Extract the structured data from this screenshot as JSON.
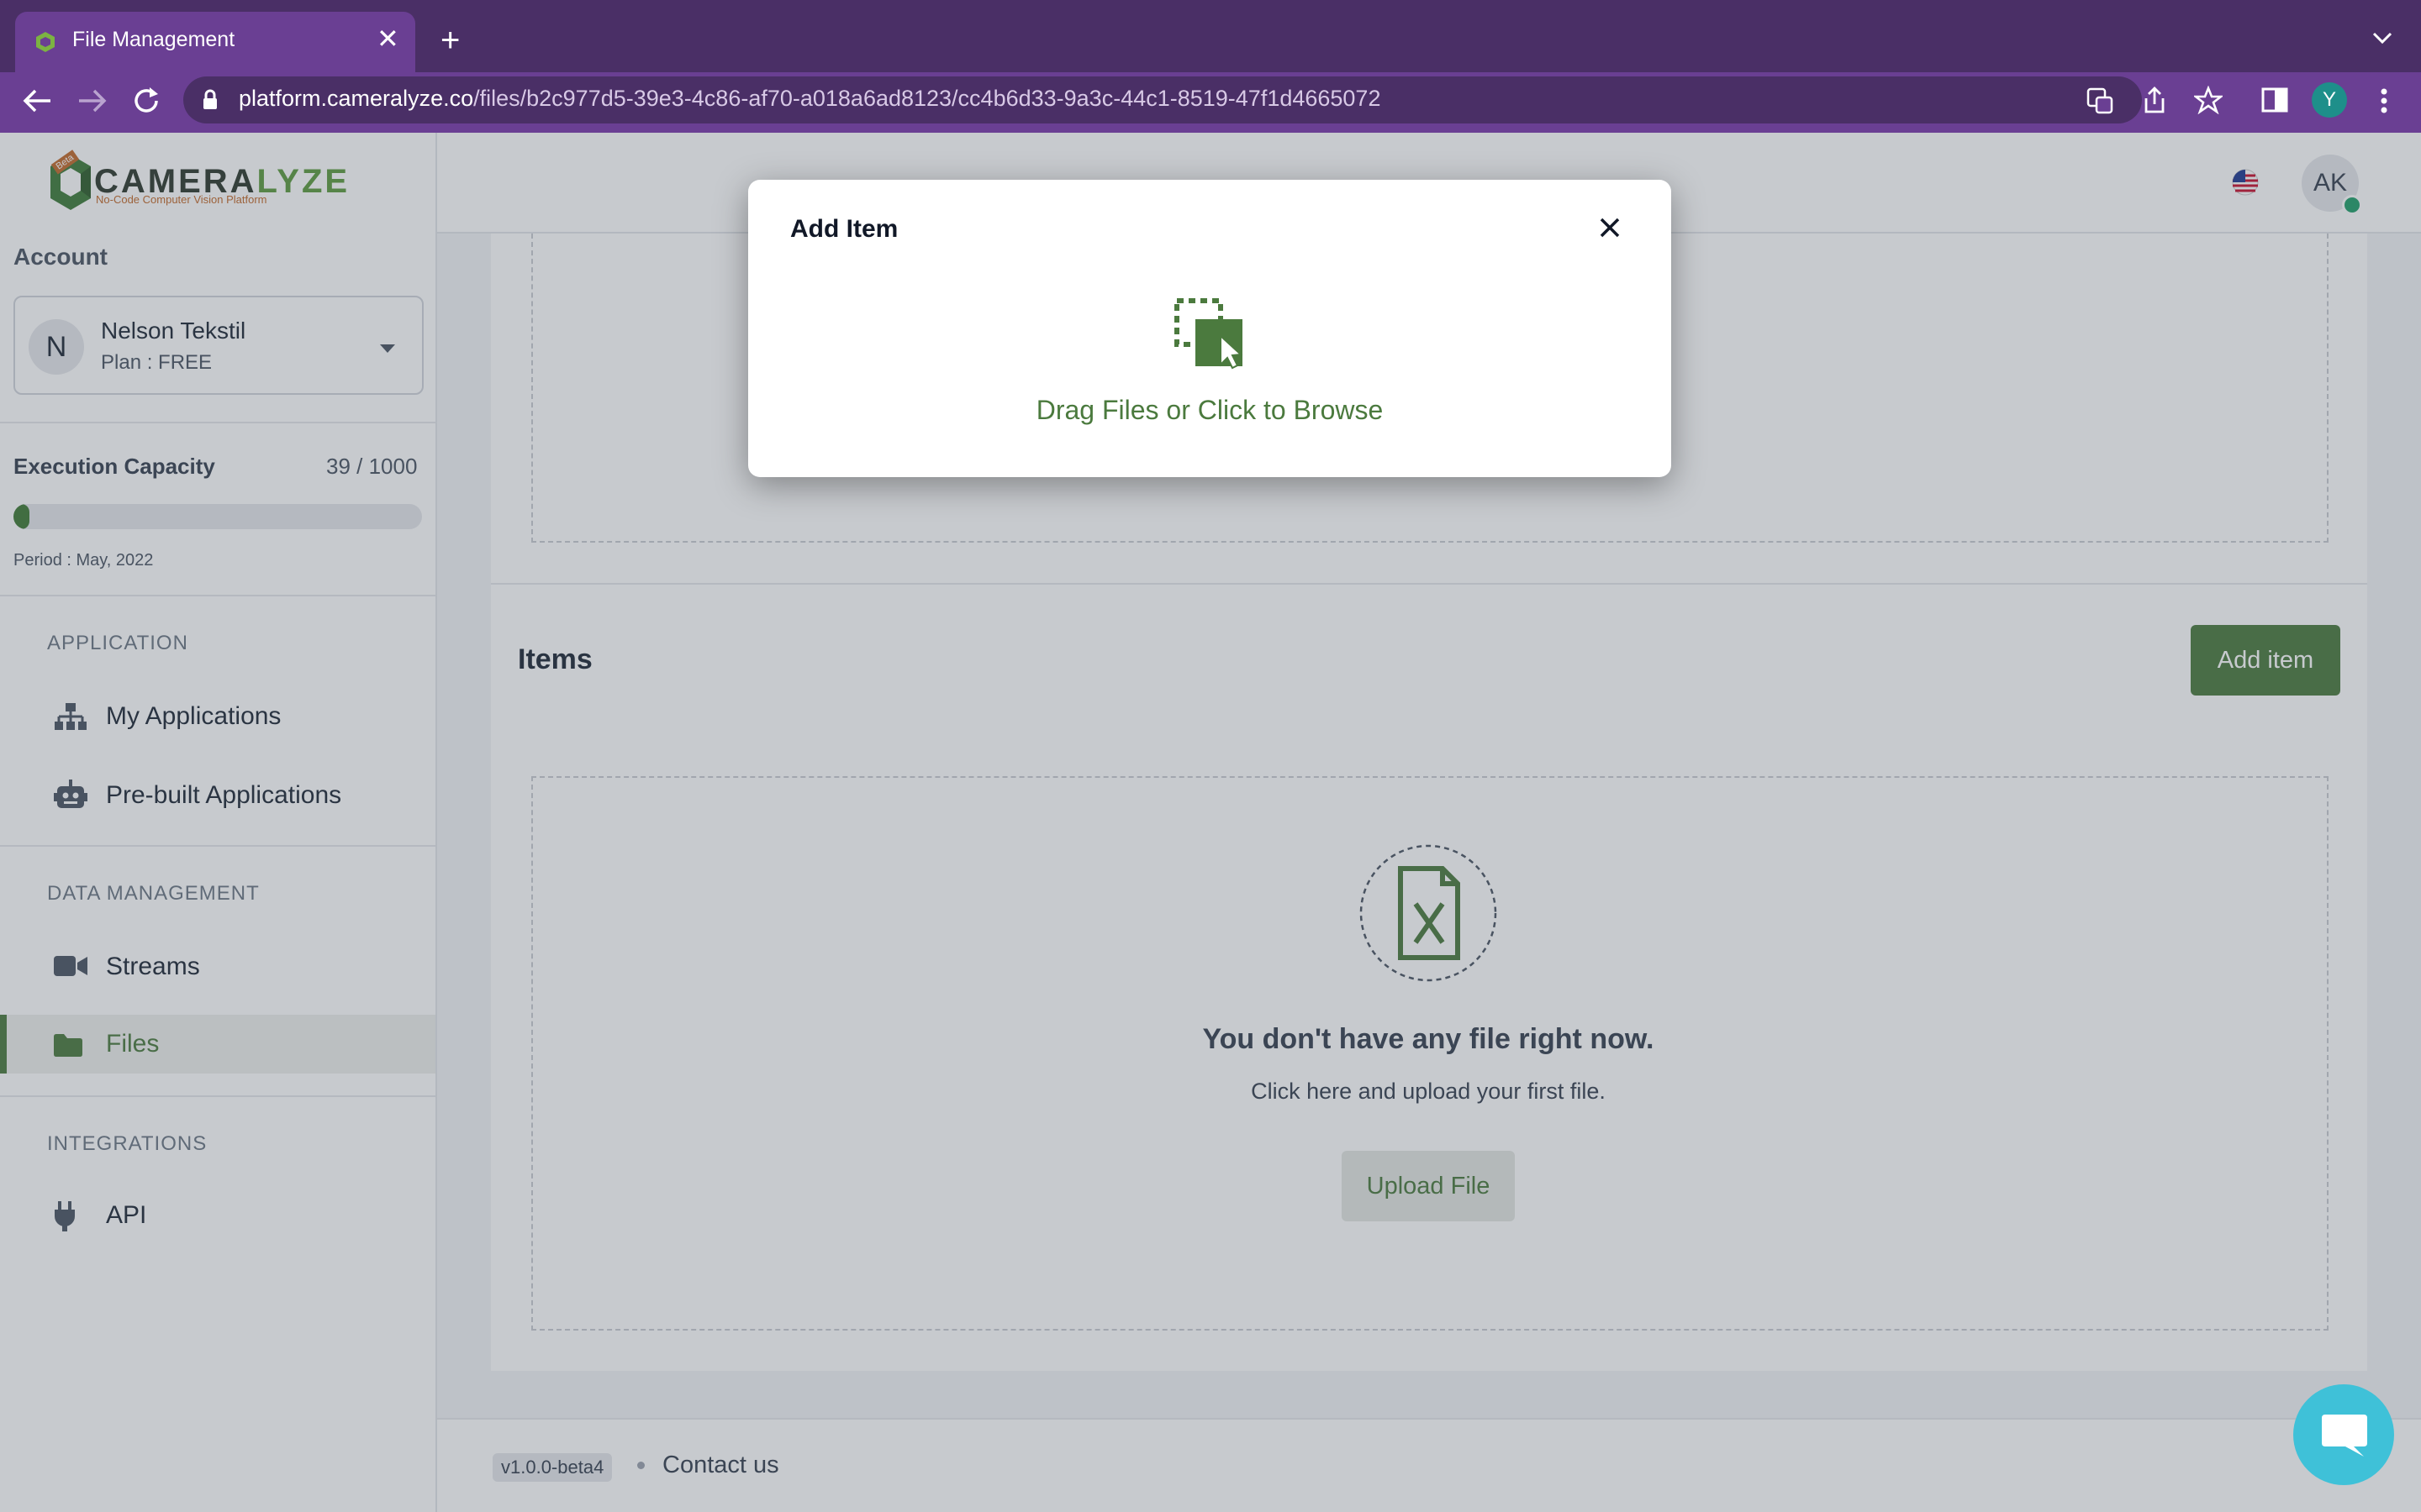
{
  "browser": {
    "tab_title": "File Management",
    "url_host": "platform.cameralyze.co",
    "url_path": "/files/b2c977d5-39e3-4c86-af70-a018a6ad8123/cc4b6d33-9a3c-44c1-8519-47f1d4665072",
    "profile_initial": "Y"
  },
  "logo": {
    "text_a": "CAMERA",
    "text_b": "LYZE",
    "tagline": "No-Code Computer Vision Platform",
    "badge": "Beta"
  },
  "header": {
    "avatar_initials": "AK"
  },
  "sidebar": {
    "account_label": "Account",
    "account": {
      "initial": "N",
      "name": "Nelson Tekstil",
      "plan": "Plan : FREE"
    },
    "capacity": {
      "label": "Execution Capacity",
      "value": "39 / 1000",
      "fraction": 0.039,
      "period": "Period : May, 2022"
    },
    "sections": [
      {
        "title": "APPLICATION",
        "items": [
          {
            "label": "My Applications",
            "icon": "sitemap-icon"
          },
          {
            "label": "Pre-built Applications",
            "icon": "robot-icon"
          }
        ]
      },
      {
        "title": "DATA MANAGEMENT",
        "items": [
          {
            "label": "Streams",
            "icon": "video-icon"
          },
          {
            "label": "Files",
            "icon": "folder-icon",
            "active": true
          }
        ]
      },
      {
        "title": "INTEGRATIONS",
        "items": [
          {
            "label": "API",
            "icon": "plug-icon"
          }
        ]
      }
    ]
  },
  "main": {
    "items_title": "Items",
    "add_item_label": "Add item",
    "empty_title": "You don't have any file right now.",
    "empty_subtitle": "Click here and upload your first file.",
    "upload_label": "Upload File"
  },
  "footer": {
    "version": "v1.0.0-beta4",
    "contact": "Contact us"
  },
  "modal": {
    "title": "Add Item",
    "dropzone_text": "Drag Files or Click to Browse"
  },
  "colors": {
    "accent": "#4b7a3e",
    "browser_purple": "#6a3f93",
    "browser_dark": "#4a2f66"
  }
}
